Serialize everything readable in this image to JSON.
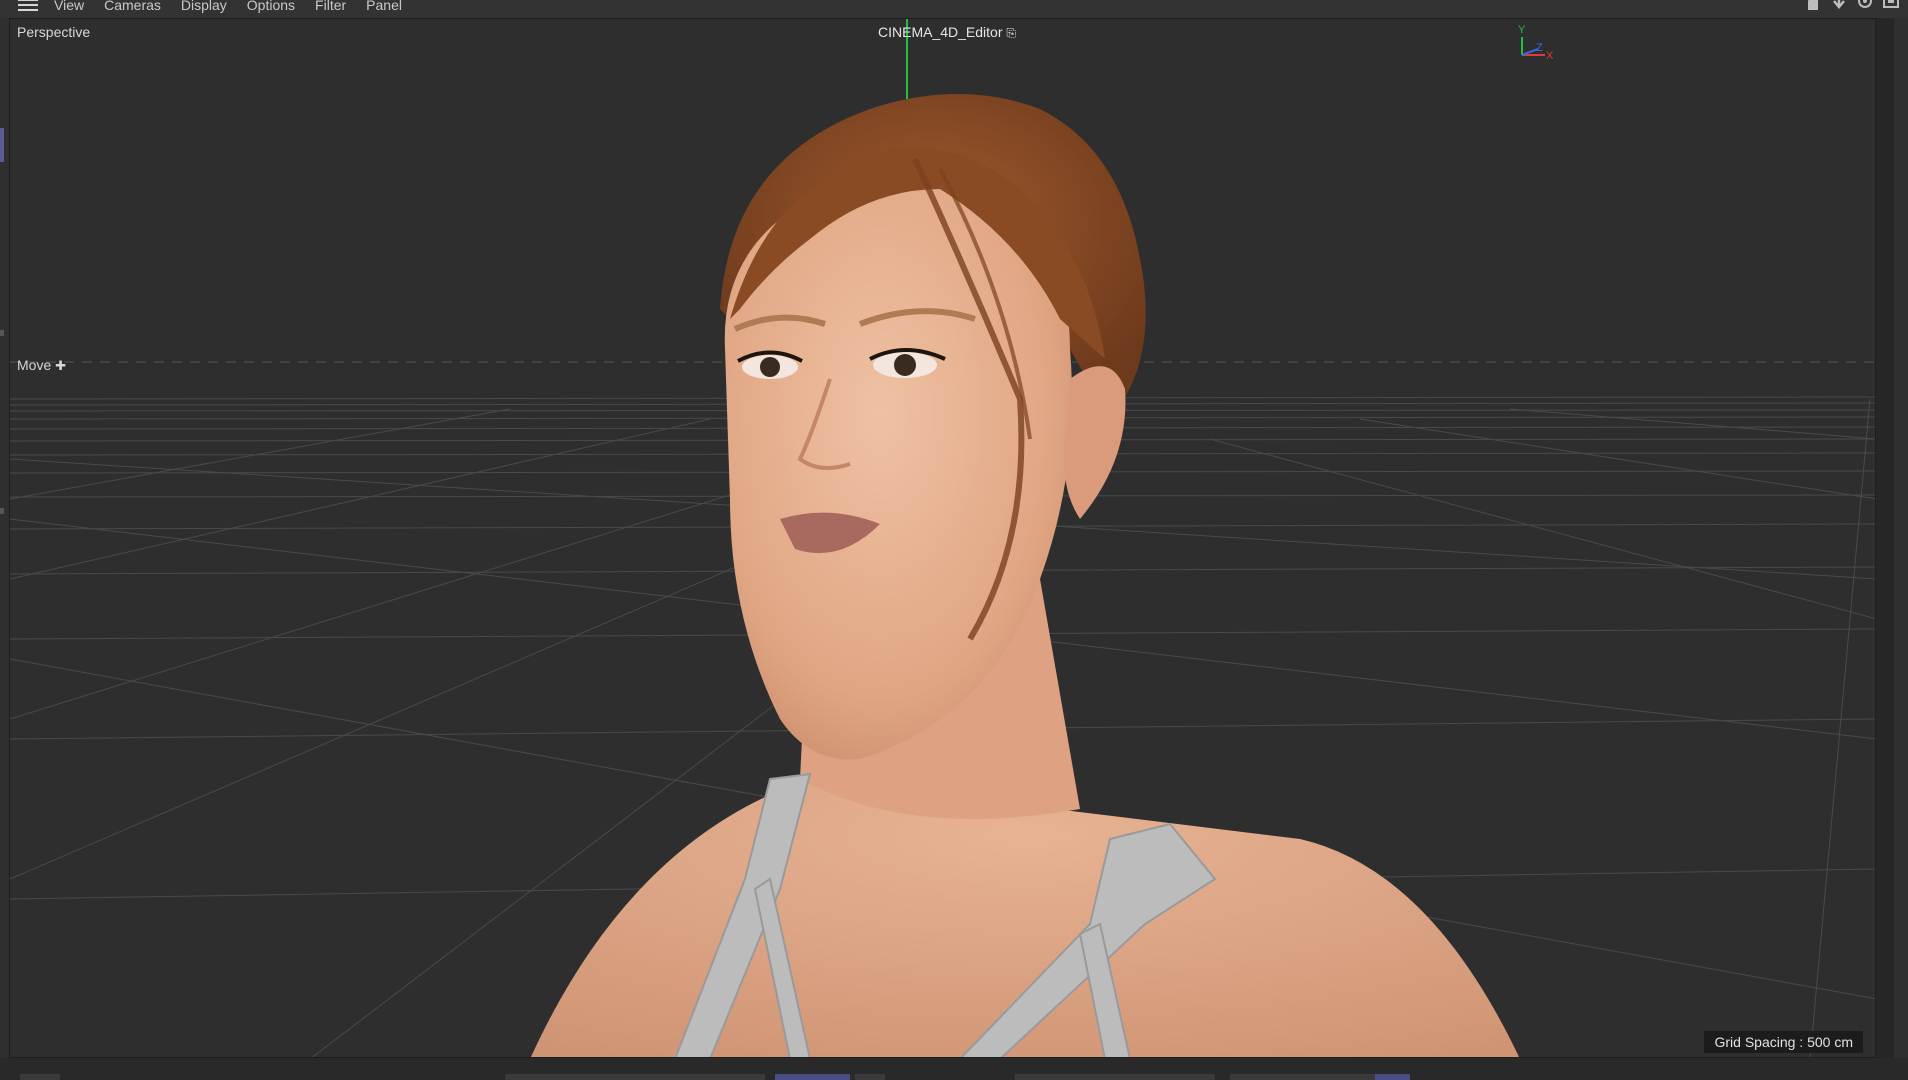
{
  "menubar": {
    "items": [
      {
        "label": "View"
      },
      {
        "label": "Cameras"
      },
      {
        "label": "Display"
      },
      {
        "label": "Options"
      },
      {
        "label": "Filter"
      },
      {
        "label": "Panel"
      }
    ],
    "right_icons": [
      "hand-icon",
      "move-down-icon",
      "orbit-icon",
      "maximize-icon"
    ]
  },
  "viewport": {
    "projection_label": "Perspective",
    "camera_label": "CINEMA_4D_Editor",
    "tool_label": "Move",
    "grid_spacing": "Grid Spacing : 500 cm",
    "axis_labels": {
      "y": "Y",
      "z": "Z",
      "x": "X"
    }
  },
  "colors": {
    "accent": "#5a5d93",
    "background": "#2e2e2e",
    "grid_line": "#4a4a4a",
    "y_axis": "#1fbf3f",
    "x_axis": "#e23a3a",
    "z_axis": "#3a6ae2",
    "skin": "#e3ad8d",
    "hair": "#8a4a24",
    "strap": "#bdbdbd"
  }
}
